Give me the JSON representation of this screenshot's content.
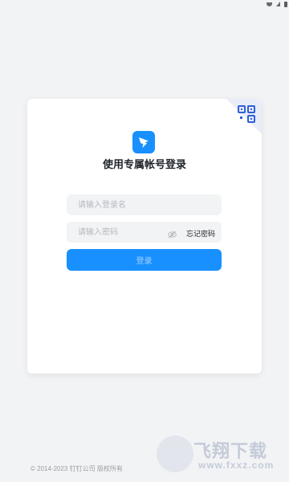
{
  "login": {
    "title": "使用专属帐号登录",
    "username_placeholder": "请输入登录名",
    "password_placeholder": "请输入密码",
    "forgot_password": "忘记密码",
    "login_button": "登录"
  },
  "footer": {
    "copyright": "© 2014-2023 钉钉公司 版权所有"
  },
  "watermark": {
    "main_text": "飞翔下载",
    "sub_text": "www.fxxz.com"
  },
  "colors": {
    "accent": "#1890ff",
    "background": "#f2f3f5",
    "card": "#ffffff"
  },
  "icons": {
    "logo": "dingtalk-logo-icon",
    "qr": "qr-code-icon",
    "eye": "eye-off-icon"
  }
}
